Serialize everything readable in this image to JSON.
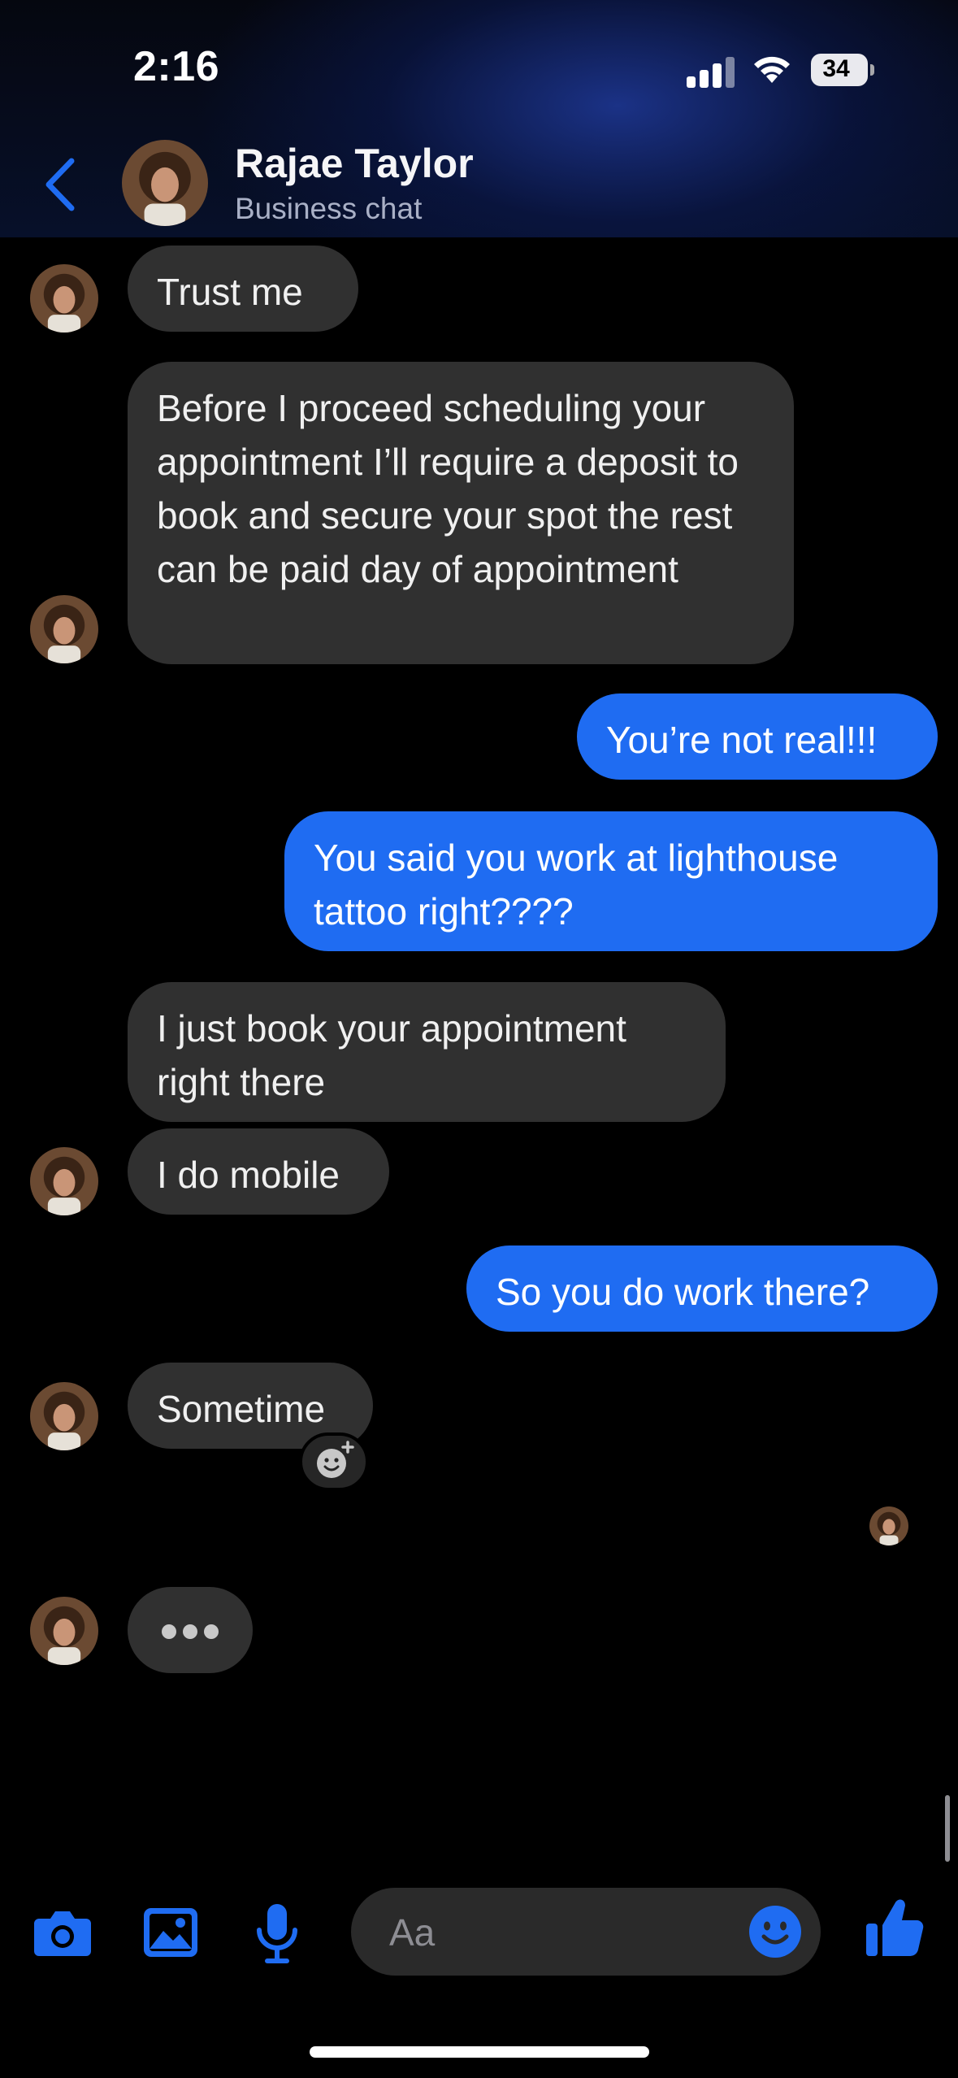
{
  "status_bar": {
    "time": "2:16",
    "battery": "34"
  },
  "header": {
    "name": "Rajae Taylor",
    "subtitle": "Business chat",
    "back_icon": "chevron-left-icon",
    "accent_color": "#1f6cf2"
  },
  "messages": [
    {
      "direction": "incoming",
      "text": "Trust  me"
    },
    {
      "direction": "incoming",
      "text": "Before I proceed scheduling your appointment I’ll require a deposit to book and secure your spot the rest can be paid day of appointment"
    },
    {
      "direction": "outgoing",
      "text": "You’re not real!!!"
    },
    {
      "direction": "outgoing",
      "text": "You said you work at lighthouse tattoo right????"
    },
    {
      "direction": "incoming",
      "text": "I just book your appointment right there"
    },
    {
      "direction": "incoming",
      "text": "I do mobile"
    },
    {
      "direction": "outgoing",
      "text": "So you do work there?"
    },
    {
      "direction": "incoming",
      "text": "Sometime"
    }
  ],
  "typing_indicator": "typing-dots-icon",
  "composer": {
    "placeholder": "Aa",
    "icons": [
      "camera-icon",
      "photo-icon",
      "microphone-icon",
      "emoji-icon",
      "thumbs-up-icon"
    ]
  },
  "colors": {
    "incoming_bubble": "#303030",
    "outgoing_bubble": "#1f6cf2",
    "background": "#000000"
  }
}
